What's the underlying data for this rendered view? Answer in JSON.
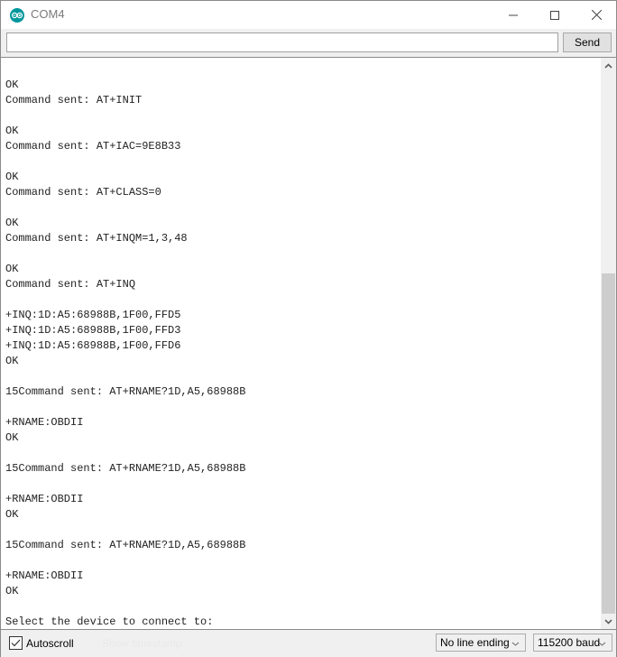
{
  "window": {
    "title": "COM4",
    "icon": "arduino-logo-icon",
    "controls": {
      "minimize": "minimize-icon",
      "maximize": "maximize-icon",
      "close": "close-icon"
    }
  },
  "input": {
    "value": "",
    "placeholder": ""
  },
  "send_label": "Send",
  "output_lines": [
    "OK",
    "Command sent: AT+INIT",
    "",
    "OK",
    "Command sent: AT+IAC=9E8B33",
    "",
    "OK",
    "Command sent: AT+CLASS=0",
    "",
    "OK",
    "Command sent: AT+INQM=1,3,48",
    "",
    "OK",
    "Command sent: AT+INQ",
    "",
    "+INQ:1D:A5:68988B,1F00,FFD5",
    "+INQ:1D:A5:68988B,1F00,FFD3",
    "+INQ:1D:A5:68988B,1F00,FFD6",
    "OK",
    "",
    "15Command sent: AT+RNAME?1D,A5,68988B",
    "",
    "+RNAME:OBDII",
    "OK",
    "",
    "15Command sent: AT+RNAME?1D,A5,68988B",
    "",
    "+RNAME:OBDII",
    "OK",
    "",
    "15Command sent: AT+RNAME?1D,A5,68988B",
    "",
    "+RNAME:OBDII",
    "OK",
    "",
    "Select the device to connect to:"
  ],
  "scroll": {
    "position_fraction": 1.0,
    "visible_fraction": 0.63
  },
  "bottom": {
    "autoscroll_label": "Autoscroll",
    "autoscroll_checked": true,
    "timestamp_label": "Show timestamp",
    "line_ending": "No line ending",
    "baud": "115200 baud"
  },
  "colors": {
    "accent": "#00979c"
  }
}
